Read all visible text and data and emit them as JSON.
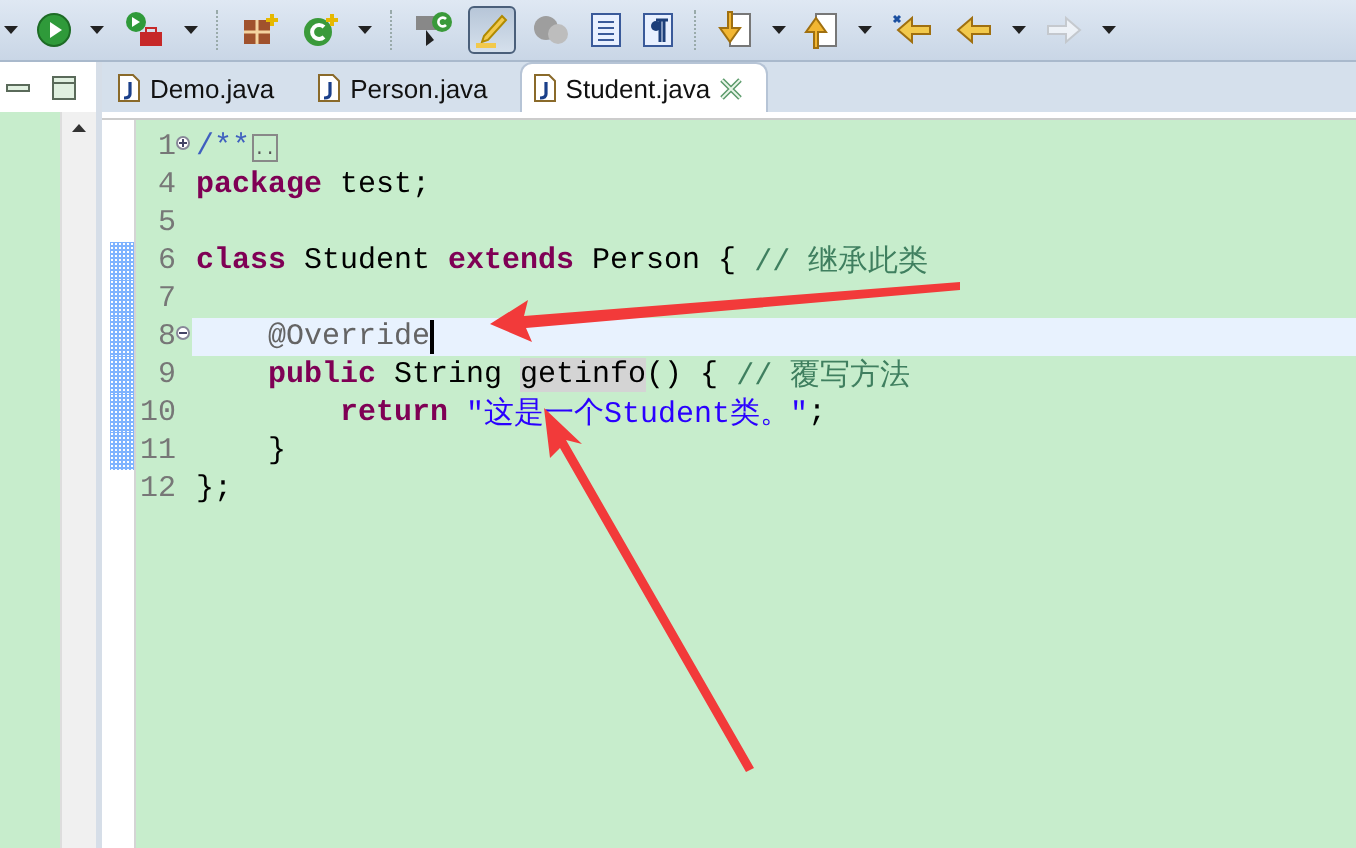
{
  "toolbar": {
    "items": [
      {
        "kind": "caret"
      },
      {
        "kind": "run"
      },
      {
        "kind": "caret"
      },
      {
        "kind": "external-tools"
      },
      {
        "kind": "caret"
      },
      {
        "kind": "separator"
      },
      {
        "kind": "new-package"
      },
      {
        "kind": "new-class"
      },
      {
        "kind": "caret"
      },
      {
        "kind": "separator"
      },
      {
        "kind": "open-type"
      },
      {
        "kind": "highlight",
        "pressed": true
      },
      {
        "kind": "mask",
        "pressed": false
      },
      {
        "kind": "document",
        "pressed": false
      },
      {
        "kind": "paragraph",
        "pressed": false
      },
      {
        "kind": "separator"
      },
      {
        "kind": "next-annotation"
      },
      {
        "kind": "caret"
      },
      {
        "kind": "prev-annotation"
      },
      {
        "kind": "caret"
      },
      {
        "kind": "last-edit"
      },
      {
        "kind": "back",
        "disabled": false
      },
      {
        "kind": "caret"
      },
      {
        "kind": "forward",
        "disabled": true
      },
      {
        "kind": "caret"
      }
    ]
  },
  "tabs": [
    {
      "label": "Demo.java",
      "selected": false
    },
    {
      "label": "Person.java",
      "selected": false
    },
    {
      "label": "Student.java",
      "selected": true
    }
  ],
  "editor": {
    "lines": [
      {
        "number": "1",
        "collapsed": true,
        "changed": false,
        "tokens": [
          {
            "kind": "doc",
            "text": "/**"
          },
          {
            "kind": "folded",
            "text": ".."
          }
        ]
      },
      {
        "number": "4",
        "changed": false,
        "tokens": [
          {
            "kind": "keyword",
            "text": "package"
          },
          {
            "kind": "plain",
            "text": " test;"
          }
        ]
      },
      {
        "number": "5",
        "changed": false
      },
      {
        "number": "6",
        "changed": true,
        "tokens": [
          {
            "kind": "keyword",
            "text": "class"
          },
          {
            "kind": "plain",
            "text": " Student "
          },
          {
            "kind": "keyword",
            "text": "extends"
          },
          {
            "kind": "plain",
            "text": " Person { "
          },
          {
            "kind": "comment",
            "text": "// 继承此类"
          }
        ]
      },
      {
        "number": "7",
        "changed": true
      },
      {
        "number": "8",
        "collapsed": false,
        "changed": true,
        "current": true,
        "caret": true,
        "tokens": [
          {
            "kind": "annotation",
            "text": "    @Override"
          }
        ]
      },
      {
        "number": "9",
        "changed": true,
        "tokens": [
          {
            "kind": "keyword",
            "text": "    public"
          },
          {
            "kind": "plain",
            "text": " String "
          },
          {
            "kind": "plain",
            "text": "getinfo",
            "highlight": true
          },
          {
            "kind": "plain",
            "text": "() { "
          },
          {
            "kind": "comment",
            "text": "// 覆写方法"
          }
        ]
      },
      {
        "number": "10",
        "changed": true,
        "tokens": [
          {
            "kind": "keyword",
            "text": "        return "
          },
          {
            "kind": "string",
            "text": "\"这是一个Student类。\""
          },
          {
            "kind": "plain",
            "text": ";"
          }
        ]
      },
      {
        "number": "11",
        "changed": true,
        "tokens": [
          {
            "kind": "plain",
            "text": "    }"
          }
        ]
      },
      {
        "number": "12",
        "changed": false,
        "tokens": [
          {
            "kind": "plain",
            "text": "};"
          }
        ]
      }
    ]
  }
}
